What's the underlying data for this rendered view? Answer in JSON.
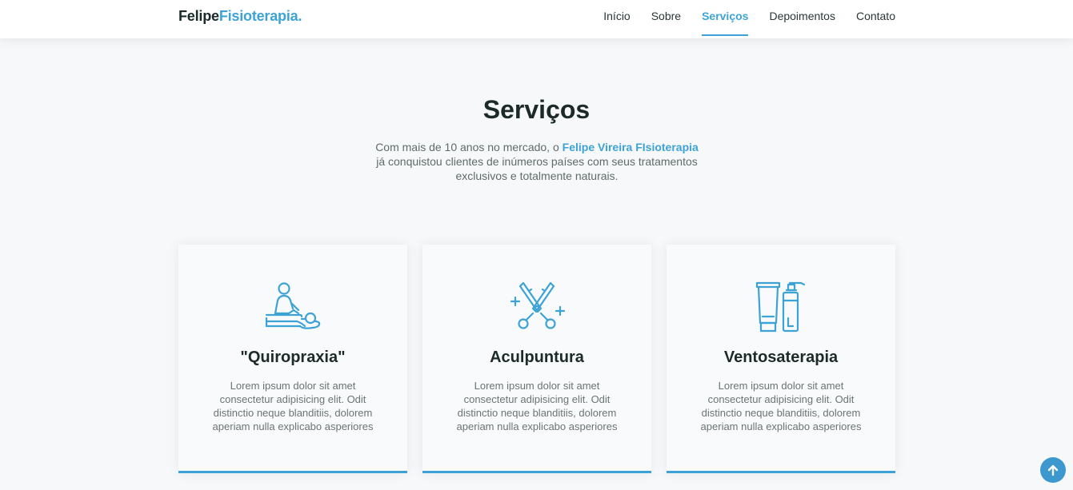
{
  "header": {
    "logo_part1": "Felipe",
    "logo_part2": "Fisioterapia",
    "logo_dot": ".",
    "nav": [
      {
        "label": "Início"
      },
      {
        "label": "Sobre"
      },
      {
        "label": "Serviços",
        "active": true
      },
      {
        "label": "Depoimentos"
      },
      {
        "label": "Contato"
      }
    ]
  },
  "section": {
    "title": "Serviços",
    "desc_before": "Com mais de 10 anos no mercado, o ",
    "desc_highlight": "Felipe Vireira FIsioterapia",
    "desc_after": " já conquistou clientes de inúmeros países com seus tratamentos exclusivos e totalmente naturais."
  },
  "cards": [
    {
      "icon": "massage-icon",
      "title": "\"Quiropraxia\"",
      "text": "Lorem ipsum dolor sit amet consectetur adipisicing elit. Odit distinctio neque blanditiis, dolorem aperiam nulla explicabo asperiores"
    },
    {
      "icon": "scissors-icon",
      "title": "Aculpuntura",
      "text": "Lorem ipsum dolor sit amet consectetur adipisicing elit. Odit distinctio neque blanditiis, dolorem aperiam nulla explicabo asperiores"
    },
    {
      "icon": "cosmetics-bottles-icon",
      "title": "Ventosaterapia",
      "text": "Lorem ipsum dolor sit amet consectetur adipisicing elit. Odit distinctio neque blanditiis, dolorem aperiam nulla explicabo asperiores"
    }
  ],
  "back_to_top": {
    "icon": "arrow-up-icon"
  },
  "colors": {
    "accent": "#3da3d6",
    "heading": "#1c2a28",
    "background": "#f7f8f9"
  }
}
